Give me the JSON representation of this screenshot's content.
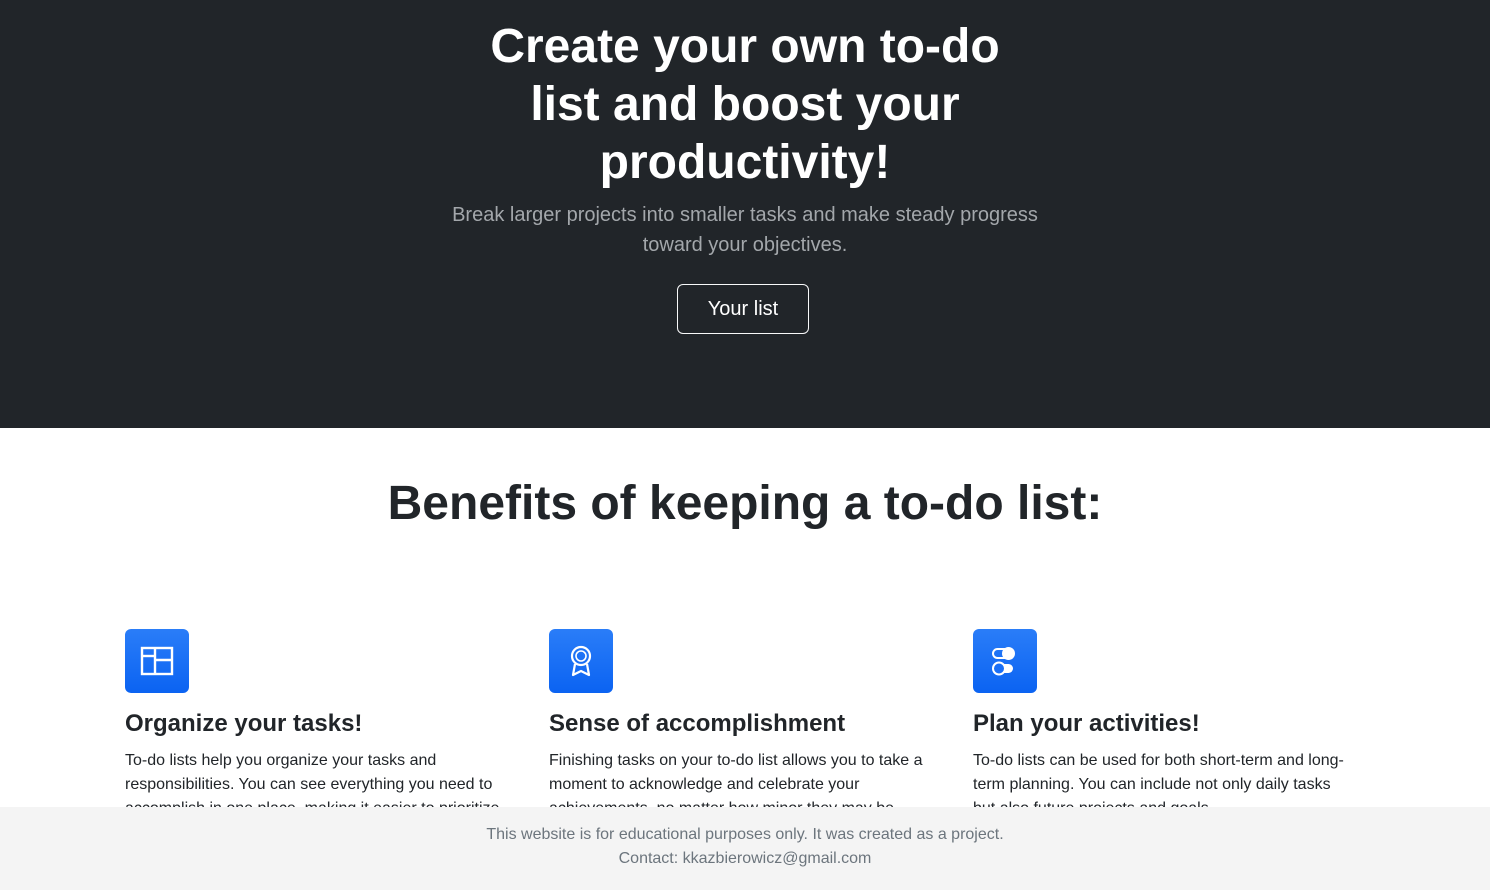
{
  "hero": {
    "title": "Create your own to-do list and boost your productivity!",
    "subtitle": "Break larger projects into smaller tasks and make steady progress toward your objectives.",
    "button_label": "Your list"
  },
  "benefits": {
    "title": "Benefits of keeping a to-do list:",
    "items": [
      {
        "icon": "layout-icon",
        "title": "Organize your tasks!",
        "text": "To-do lists help you organize your tasks and responsibilities. You can see everything you need to accomplish in one place, making it easier to prioritize"
      },
      {
        "icon": "award-icon",
        "title": "Sense of accomplishment",
        "text": "Finishing tasks on your to-do list allows you to take a moment to acknowledge and celebrate your achievements, no matter how minor they may be."
      },
      {
        "icon": "toggles-icon",
        "title": "Plan your activities!",
        "text": "To-do lists can be used for both short-term and long-term planning. You can include not only daily tasks but also future projects and goals."
      }
    ]
  },
  "footer": {
    "line1": "This website is for educational purposes only. It was created as a project.",
    "line2": "Contact: kkazbierowicz@gmail.com"
  },
  "colors": {
    "hero_bg": "#212529",
    "accent": "#0d6efd",
    "footer_bg": "#f4f4f4"
  }
}
